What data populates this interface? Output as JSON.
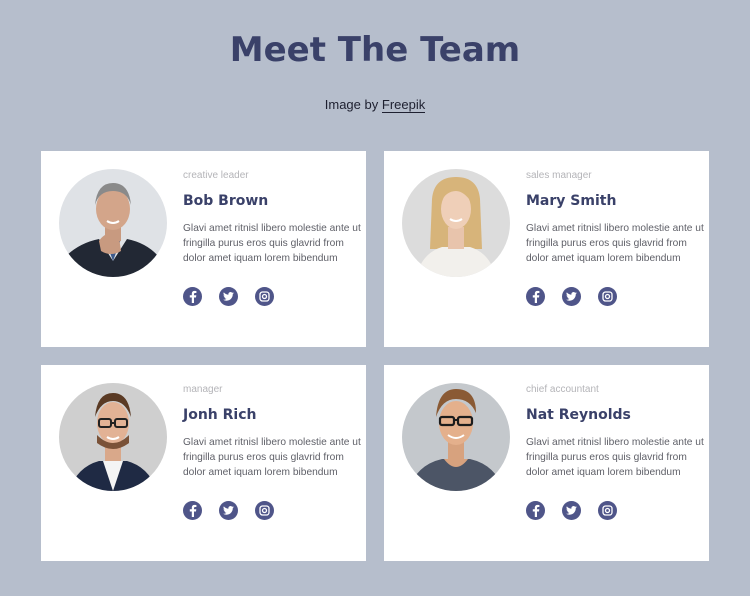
{
  "header": {
    "title": "Meet The Team",
    "credit_prefix": "Image by",
    "credit_link": "Freepik"
  },
  "colors": {
    "background": "#b6becc",
    "accent": "#3a4169",
    "icon": "#4f5589"
  },
  "team": [
    {
      "role": "creative leader",
      "name": "Bob Brown",
      "description": "Glavi amet ritnisl libero molestie ante ut fringilla purus eros quis glavrid from dolor amet iquam lorem bibendum",
      "social": [
        "facebook-icon",
        "twitter-icon",
        "instagram-icon"
      ]
    },
    {
      "role": "sales manager",
      "name": "Mary Smith",
      "description": "Glavi amet ritnisl libero molestie ante ut fringilla purus eros quis glavrid from dolor amet iquam lorem bibendum",
      "social": [
        "facebook-icon",
        "twitter-icon",
        "instagram-icon"
      ]
    },
    {
      "role": "manager",
      "name": "Jonh Rich",
      "description": "Glavi amet ritnisl libero molestie ante ut fringilla purus eros quis glavrid from dolor amet iquam lorem bibendum",
      "social": [
        "facebook-icon",
        "twitter-icon",
        "instagram-icon"
      ]
    },
    {
      "role": "chief accountant",
      "name": "Nat Reynolds",
      "description": "Glavi amet ritnisl libero molestie ante ut fringilla purus eros quis glavrid from dolor amet iquam lorem bibendum",
      "social": [
        "facebook-icon",
        "twitter-icon",
        "instagram-icon"
      ]
    }
  ]
}
